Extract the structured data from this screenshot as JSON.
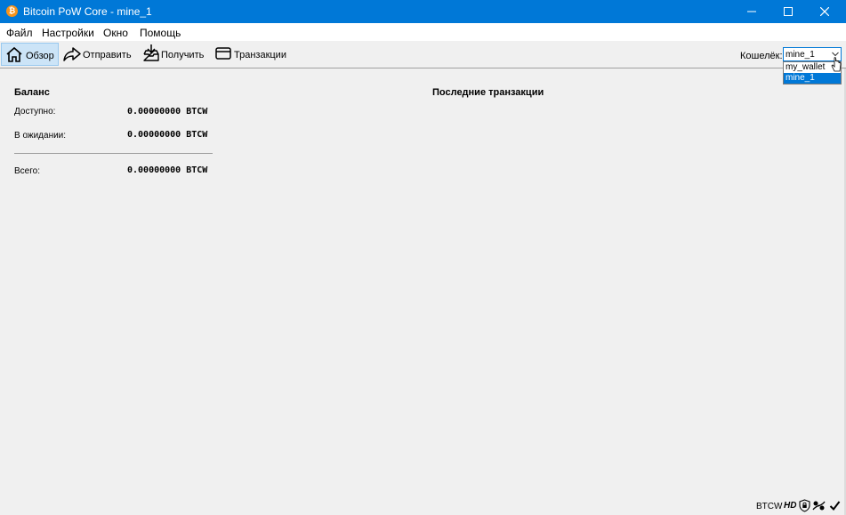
{
  "window": {
    "title": "Bitcoin PoW Core - mine_1",
    "app_icon_glyph": "₿",
    "controls": [
      "minimize-icon",
      "maximize-icon",
      "close-icon"
    ]
  },
  "menu": {
    "items": [
      {
        "label": "Файл"
      },
      {
        "label": "Настройки"
      },
      {
        "label": "Окно"
      },
      {
        "label": "Помощь"
      }
    ]
  },
  "toolbar": {
    "buttons": [
      {
        "label": "Обзор",
        "icon": "home-icon",
        "active": true
      },
      {
        "label": "Отправить",
        "icon": "send-arrow-icon",
        "active": false
      },
      {
        "label": "Получить",
        "icon": "receive-inbox-icon",
        "active": false
      },
      {
        "label": "Транзакции",
        "icon": "card-icon",
        "active": false
      }
    ]
  },
  "wallet": {
    "label": "Кошелёк:",
    "selected": "mine_1",
    "options": [
      "my_wallet",
      "mine_1"
    ],
    "highlighted_option": "mine_1"
  },
  "balance": {
    "title": "Баланс",
    "available_label": "Доступно:",
    "available_value": "0.00000000 BTCW",
    "pending_label": "В ожидании:",
    "pending_value": "0.00000000 BTCW",
    "total_label": "Всего:",
    "total_value": "0.00000000 BTCW"
  },
  "recent": {
    "title": "Последние транзакции"
  },
  "status": {
    "unit": "BTCW",
    "hd": "HD",
    "icons": [
      "shield-lock-icon",
      "network-connection-icon",
      "synced-check-icon"
    ]
  },
  "colors": {
    "titlebar": "#0078d7",
    "accent": "#0078d7",
    "active_tab": "#cce4f7",
    "background": "#f0f0f0"
  }
}
